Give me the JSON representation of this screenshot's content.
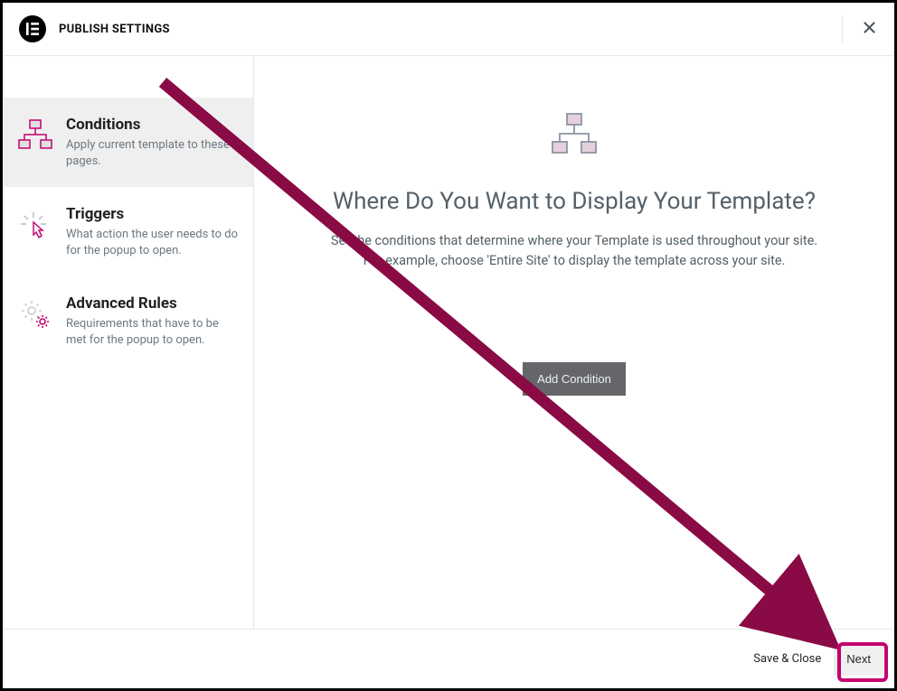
{
  "header": {
    "title": "PUBLISH SETTINGS"
  },
  "sidebar": {
    "items": [
      {
        "title": "Conditions",
        "desc": "Apply current template to these pages."
      },
      {
        "title": "Triggers",
        "desc": "What action the user needs to do for the popup to open."
      },
      {
        "title": "Advanced Rules",
        "desc": "Requirements that have to be met for the popup to open."
      }
    ]
  },
  "main": {
    "title": "Where Do You Want to Display Your Template?",
    "subtitle_line1": "Set the conditions that determine where your Template is used throughout your site.",
    "subtitle_line2": "For example, choose 'Entire Site' to display the template across your site.",
    "add_button_label": "Add Condition"
  },
  "footer": {
    "save_close_label": "Save & Close",
    "next_label": "Next"
  }
}
